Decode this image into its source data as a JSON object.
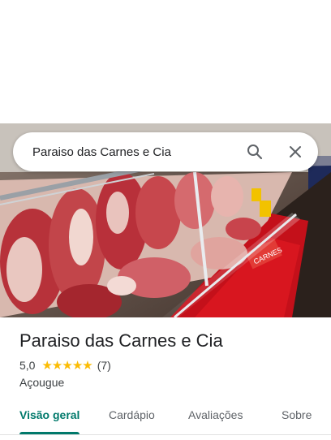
{
  "search": {
    "query": "Paraiso das Carnes e Cia",
    "search_icon": "search-icon",
    "close_icon": "close-icon"
  },
  "place": {
    "name": "Paraiso das Carnes e Cia",
    "rating": "5,0",
    "rating_value": 5.0,
    "stars_max": 5,
    "review_count": "(7)",
    "category": "Açougue"
  },
  "tabs": [
    {
      "label": "Visão geral",
      "active": true
    },
    {
      "label": "Cardápio",
      "active": false
    },
    {
      "label": "Avaliações",
      "active": false
    },
    {
      "label": "Sobre",
      "active": false
    }
  ],
  "colors": {
    "accent": "#00796b",
    "star": "#fbbc04"
  }
}
